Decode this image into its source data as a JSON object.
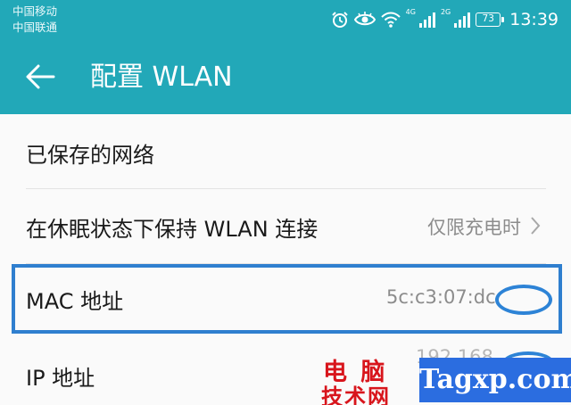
{
  "status_bar": {
    "carrier_1": "中国移动",
    "carrier_2": "中国联通",
    "network_1": "4G",
    "network_2": "2G",
    "battery": "73",
    "time": "13:39",
    "icons": [
      "alarm-icon",
      "eye-comfort-icon",
      "wifi-icon",
      "signal-icon",
      "signal-icon",
      "battery-icon"
    ]
  },
  "app_bar": {
    "back_icon": "arrow-left-icon",
    "title": "配置 WLAN"
  },
  "settings": {
    "saved_networks": {
      "label": "已保存的网络"
    },
    "keep_wlan_on_sleep": {
      "label": "在休眠状态下保持 WLAN 连接",
      "value": "仅限充电时"
    },
    "mac_address": {
      "label": "MAC 地址",
      "value": "5c:c3:07:dc:"
    },
    "ip_address": {
      "label": "IP 地址",
      "value": "192.168."
    }
  },
  "watermark": {
    "cn_line_1": "电 脑",
    "cn_line_2": "技术网",
    "site": "Tagxp.com"
  },
  "colors": {
    "app_bar": "#22a8b8",
    "highlight": "#2f7fcf",
    "watermark_red": "#d8151c",
    "watermark_blue": "#2b6de0"
  }
}
